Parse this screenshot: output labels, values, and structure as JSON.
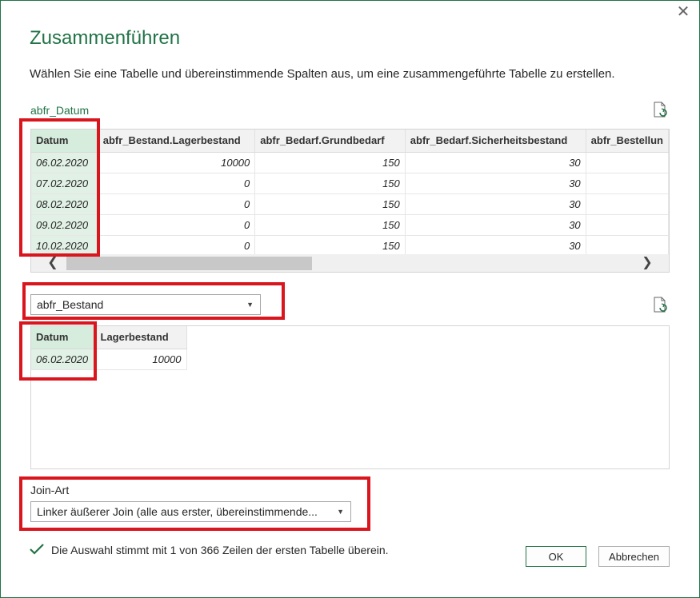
{
  "dialog": {
    "title": "Zusammenführen",
    "subtitle": "Wählen Sie eine Tabelle und übereinstimmende Spalten aus, um eine zusammengeführte Tabelle zu erstellen.",
    "close_glyph": "✕"
  },
  "table1": {
    "name": "abfr_Datum",
    "columns": [
      "Datum",
      "abfr_Bestand.Lagerbestand",
      "abfr_Bedarf.Grundbedarf",
      "abfr_Bedarf.Sicherheitsbestand",
      "abfr_Bestellun"
    ],
    "rows": [
      [
        "06.02.2020",
        "10000",
        "150",
        "30",
        ""
      ],
      [
        "07.02.2020",
        "0",
        "150",
        "30",
        ""
      ],
      [
        "08.02.2020",
        "0",
        "150",
        "30",
        ""
      ],
      [
        "09.02.2020",
        "0",
        "150",
        "30",
        ""
      ],
      [
        "10.02.2020",
        "0",
        "150",
        "30",
        ""
      ]
    ],
    "selected_column": "Datum"
  },
  "table2_select": {
    "value": "abfr_Bestand"
  },
  "table2": {
    "columns": [
      "Datum",
      "Lagerbestand"
    ],
    "rows": [
      [
        "06.02.2020",
        "10000"
      ]
    ],
    "selected_column": "Datum"
  },
  "join": {
    "label": "Join-Art",
    "value": "Linker äußerer Join (alle aus erster, übereinstimmende..."
  },
  "status": {
    "text": "Die Auswahl stimmt mit 1 von 366 Zeilen der ersten Tabelle überein.",
    "icon": "check-icon"
  },
  "buttons": {
    "ok": "OK",
    "cancel": "Abbrechen"
  },
  "colors": {
    "accent": "#217346",
    "highlight": "#d9151d",
    "selected_column": "#d6ecdc"
  }
}
